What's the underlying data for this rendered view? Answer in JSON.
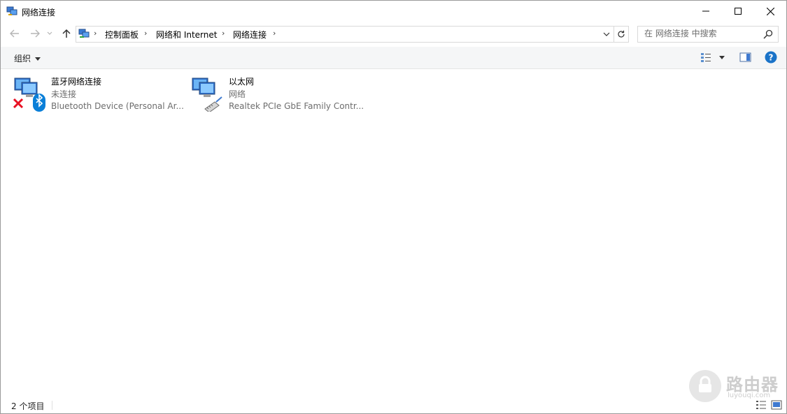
{
  "window": {
    "title": "网络连接",
    "controls": {
      "minimize": "minimize-icon",
      "maximize": "maximize-icon",
      "close": "close-icon"
    }
  },
  "nav": {
    "back": "arrow-left-icon",
    "forward": "arrow-right-icon",
    "recent": "chevron-down-icon",
    "up": "arrow-up-icon"
  },
  "address": {
    "breadcrumbs": [
      "控制面板",
      "网络和 Internet",
      "网络连接"
    ],
    "separator": "›"
  },
  "search": {
    "placeholder": "在 网络连接 中搜索"
  },
  "toolbar": {
    "organize_label": "组织"
  },
  "items": [
    {
      "name": "蓝牙网络连接",
      "status": "未连接",
      "device": "Bluetooth Device (Personal Ar...",
      "icon": "bluetooth-network-icon"
    },
    {
      "name": "以太网",
      "status": "网络",
      "device": "Realtek PCIe GbE Family Contr...",
      "icon": "ethernet-network-icon"
    }
  ],
  "statusbar": {
    "count": "2 个项目"
  },
  "watermark": {
    "name": "路由器",
    "url": "luyouqi.com"
  },
  "colors": {
    "accent": "#0078d7",
    "help": "#1a73c8",
    "error_x": "#e81123"
  }
}
